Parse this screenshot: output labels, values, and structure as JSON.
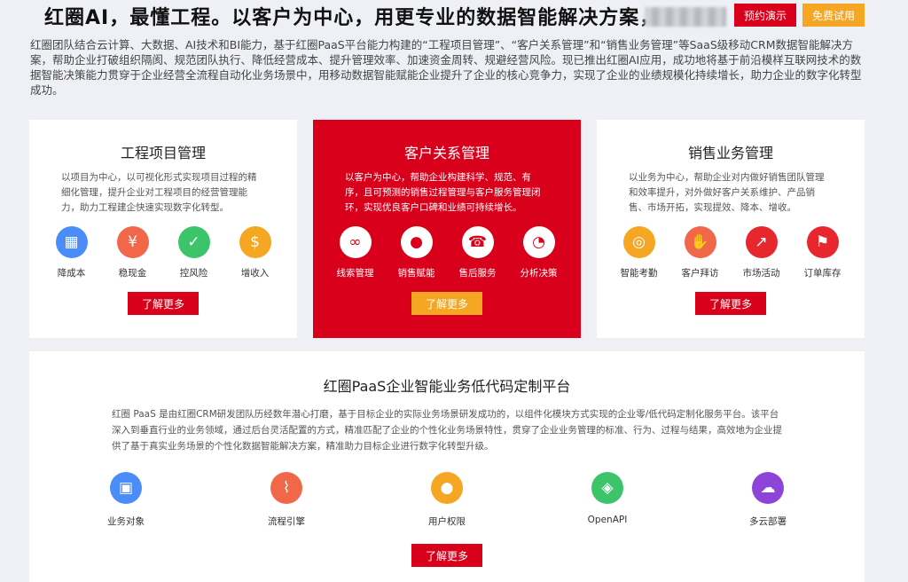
{
  "header": {
    "headline": "红圈AI，最懂工程。以客户为中心，用更专业的数据智能解决方案，",
    "demo_label": "预约演示",
    "trial_label": "免费试用"
  },
  "intro": "红圈团队结合云计算、大数据、AI技术和BI能力，基于红圈PaaS平台能力构建的“工程项目管理”、“客户关系管理”和“销售业务管理”等SaaS级移动CRM数据智能解决方案，帮助企业打破组织隔阂、规范团队执行、降低经营成本、提升管理效率、加速资金周转、规避经营风险。现已推出红圈AI应用，成功地将基于前沿模样互联网技术的数据智能决策能力贯穿于企业经营全流程自动化业务场景中，用移动数据智能赋能企业提升了企业的核心竞争力，实现了企业的业绩规模化持续增长，助力企业的数字化转型成功。",
  "cards": [
    {
      "title": "工程项目管理",
      "desc": "以项目为中心，以可视化形式实现项目过程的精细化管理，提升企业对工程项目的经营管理能力，助力工程建企快速实现数字化转型。",
      "items": [
        {
          "label": "降成本",
          "icon": "cost-chart-icon",
          "glyph": "▦",
          "color": "#4b8df8"
        },
        {
          "label": "稳现金",
          "icon": "money-bag-icon",
          "glyph": "¥",
          "color": "#f0674a"
        },
        {
          "label": "控风险",
          "icon": "checklist-icon",
          "glyph": "✓",
          "color": "#3cc46a"
        },
        {
          "label": "增收入",
          "icon": "coin-hand-icon",
          "glyph": "$",
          "color": "#f5a623"
        }
      ],
      "more": "了解更多"
    },
    {
      "title": "客户关系管理",
      "desc": "以客户为中心，帮助企业构建科学、规范、有序，且可预测的销售过程管理与客户服务管理闭环，实现优良客户口碑和业绩可持续增长。",
      "items": [
        {
          "label": "线索管理",
          "icon": "link-icon",
          "glyph": "∞"
        },
        {
          "label": "销售赋能",
          "icon": "user-icon",
          "glyph": "●"
        },
        {
          "label": "售后服务",
          "icon": "service-icon",
          "glyph": "☎"
        },
        {
          "label": "分析决策",
          "icon": "pie-chart-icon",
          "glyph": "◔"
        }
      ],
      "more": "了解更多"
    },
    {
      "title": "销售业务管理",
      "desc": "以业务为中心，帮助企业对内做好销售团队管理和效率提升，对外做好客户关系维护、产品销售、市场开拓，实现提效、降本、增收。",
      "items": [
        {
          "label": "智能考勤",
          "icon": "target-icon",
          "glyph": "◎",
          "color": "#f5a623"
        },
        {
          "label": "客户拜访",
          "icon": "handshake-icon",
          "glyph": "✋",
          "color": "#f0674a"
        },
        {
          "label": "市场活动",
          "icon": "trend-icon",
          "glyph": "↗",
          "color": "#e8262d"
        },
        {
          "label": "订单库存",
          "icon": "flag-icon",
          "glyph": "⚑",
          "color": "#e8262d"
        }
      ],
      "more": "了解更多"
    }
  ],
  "paas": {
    "title": "红圈PaaS企业智能业务低代码定制平台",
    "desc": "红圈 PaaS 是由红圈CRM研发团队历经数年潜心打磨，基于目标企业的实际业务场景研发成功的，以组件化模块方式实现的企业零/低代码定制化服务平台。该平台深入到垂直行业的业务领域，通过后台灵活配置的方式，精准匹配了企业的个性化业务场景特性，贯穿了企业业务管理的标准、行为、过程与结果，高效地为企业提供了基于真实业务场景的个性化数据智能解决方案，精准助力目标企业进行数字化转型升级。",
    "items": [
      {
        "label": "业务对象",
        "icon": "briefcase-icon",
        "glyph": "▣",
        "color": "#4b8df8"
      },
      {
        "label": "流程引擎",
        "icon": "flow-icon",
        "glyph": "⌇",
        "color": "#f0674a"
      },
      {
        "label": "用户权限",
        "icon": "user-lock-icon",
        "glyph": "●",
        "color": "#f5a623"
      },
      {
        "label": "OpenAPI",
        "icon": "cube-icon",
        "glyph": "◈",
        "color": "#3cc46a"
      },
      {
        "label": "多云部署",
        "icon": "cloud-icon",
        "glyph": "☁",
        "color": "#8e44d9"
      }
    ],
    "more": "了解更多"
  }
}
